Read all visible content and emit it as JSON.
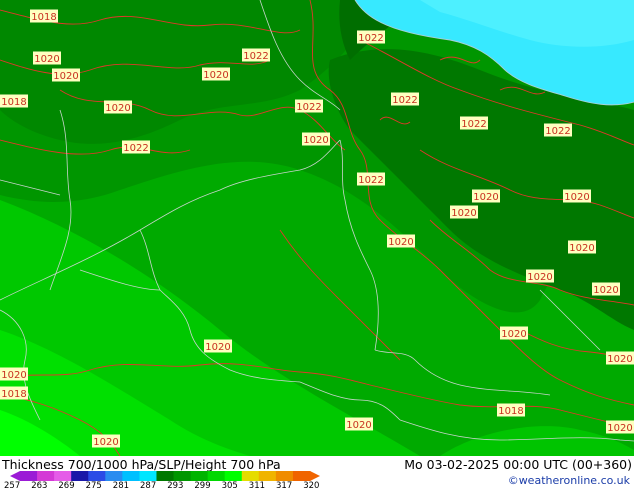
{
  "footer": {
    "product": "Thickness 700/1000 hPa/SLP/Height 700 hPa",
    "datetime": "Mo 03-02-2025 00:00 UTC (00+360)",
    "credit": "©weatheronline.co.uk"
  },
  "colorbar": {
    "colors": [
      "#9b1bd6",
      "#d43ad6",
      "#e55ce8",
      "#1a18a8",
      "#2b4be6",
      "#2a8cf0",
      "#00c0ff",
      "#00e6ff",
      "#007800",
      "#009600",
      "#00b400",
      "#00d800",
      "#00ff00",
      "#e6dc00",
      "#f0b400",
      "#f08c00",
      "#f06400"
    ],
    "ticks": [
      "257",
      "263",
      "269",
      "275",
      "281",
      "287",
      "293",
      "299",
      "305",
      "311",
      "317",
      "320"
    ]
  },
  "isobar_labels": [
    "1018",
    "1020",
    "1020",
    "1022",
    "1022",
    "1020",
    "1020",
    "1022",
    "1022",
    "1020",
    "1022",
    "1022",
    "1022",
    "1022",
    "1020",
    "1020",
    "1020",
    "1020",
    "1020",
    "1020",
    "1020",
    "1020",
    "1020",
    "1020",
    "1020",
    "1020",
    "1018",
    "1020",
    "1018",
    "1020",
    "1018"
  ],
  "colors": {
    "ocean_cyan": "#37e9ff",
    "dark_green": "#007800",
    "mid_green": "#009600",
    "green": "#00b400",
    "bright_green": "#00d800",
    "lime": "#00ff00",
    "isobar": "#e0382a",
    "border": "#b8c8c0",
    "label_bg": "#ffffc0"
  }
}
